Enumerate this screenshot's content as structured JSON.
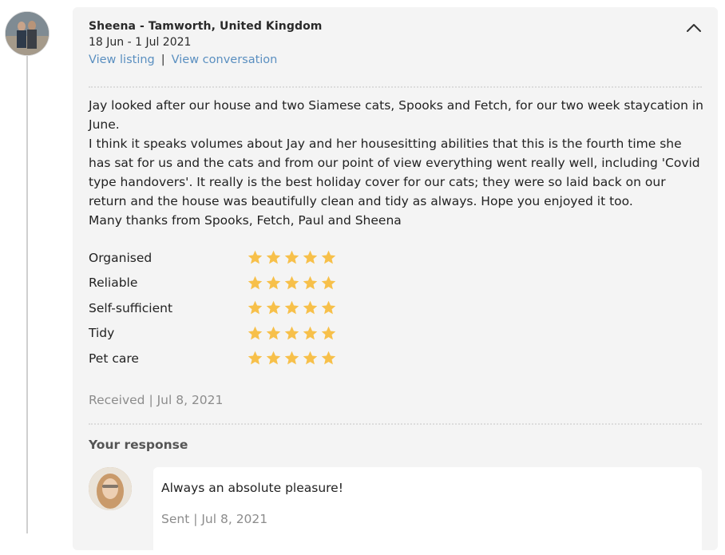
{
  "review": {
    "reviewer": "Sheena - Tamworth, United Kingdom",
    "dates": "18 Jun - 1 Jul 2021",
    "links": {
      "view_listing": "View listing",
      "separator": "|",
      "view_conversation": "View conversation"
    },
    "text": [
      "Jay looked after our house and two Siamese cats, Spooks and Fetch, for our two week staycation in June.",
      "I think it speaks volumes about Jay and her housesitting abilities that this is the fourth time she has sat for us and the cats and from our point of view everything went really well, including 'Covid type handovers'. It really is the best holiday cover for our cats; they were so laid back on our return and the house was beautifully clean and tidy as always. Hope you enjoyed it too.",
      "Many thanks from Spooks, Fetch, Paul and Sheena"
    ],
    "ratings": [
      {
        "label": "Organised",
        "stars": 5,
        "max": 5
      },
      {
        "label": "Reliable",
        "stars": 5,
        "max": 5
      },
      {
        "label": "Self-sufficient",
        "stars": 5,
        "max": 5
      },
      {
        "label": "Tidy",
        "stars": 5,
        "max": 5
      },
      {
        "label": "Pet care",
        "stars": 5,
        "max": 5
      }
    ],
    "received": "Received | Jul 8, 2021"
  },
  "response": {
    "heading": "Your response",
    "text": "Always an absolute pleasure!",
    "sent": "Sent | Jul 8, 2021"
  },
  "colors": {
    "star": "#f7c04a",
    "link": "#5a8fc0",
    "card_bg": "#f4f4f4"
  },
  "icons": {
    "collapse": "chevron-up-icon",
    "star": "star-icon"
  }
}
